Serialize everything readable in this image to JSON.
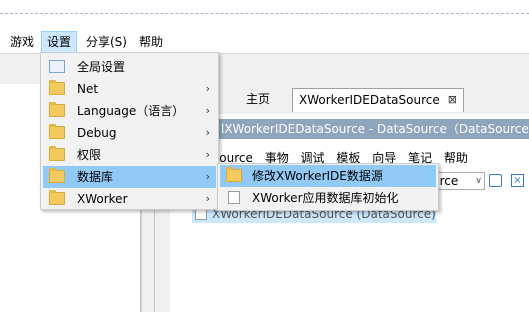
{
  "menubar": {
    "items": [
      {
        "label": "游戏"
      },
      {
        "label": "设置"
      },
      {
        "label": "分享(S)"
      },
      {
        "label": "帮助"
      }
    ]
  },
  "settings_menu": {
    "items": [
      {
        "label": "全局设置",
        "icon": "settings-doc-icon",
        "has_submenu": false
      },
      {
        "label": "Net",
        "icon": "folder-icon",
        "has_submenu": true
      },
      {
        "label": "Language（语言）",
        "icon": "folder-icon",
        "has_submenu": true
      },
      {
        "label": "Debug",
        "icon": "folder-icon",
        "has_submenu": true
      },
      {
        "label": "权限",
        "icon": "folder-icon",
        "has_submenu": true
      },
      {
        "label": "数据库",
        "icon": "folder-icon",
        "has_submenu": true,
        "highlighted": true
      },
      {
        "label": "XWorker",
        "icon": "folder-icon",
        "has_submenu": true
      }
    ],
    "arrow": "›"
  },
  "database_submenu": {
    "items": [
      {
        "label": "修改XWorkerIDE数据源",
        "icon": "folder-doc-icon",
        "highlighted": true
      },
      {
        "label": "XWorker应用数据库初始化",
        "icon": "document-icon"
      }
    ]
  },
  "tabs": {
    "home": "主页",
    "active": "XWorkerIDEDataSource",
    "close": "⊠"
  },
  "editor": {
    "title": "lXWorkerIDEDataSource - DataSource（DataSource）",
    "menu": [
      "source",
      "事物",
      "调试",
      "模板",
      "向导",
      "笔记",
      "帮助"
    ],
    "combo_value": "urce",
    "combo_arrow": "∨",
    "tree_item": "XWorkerIDEDataSource (DataSource)"
  },
  "colors": {
    "highlight": "#91c9f7",
    "menubar_active": "#cce8ff",
    "title_bar": "#8fa5bd"
  }
}
